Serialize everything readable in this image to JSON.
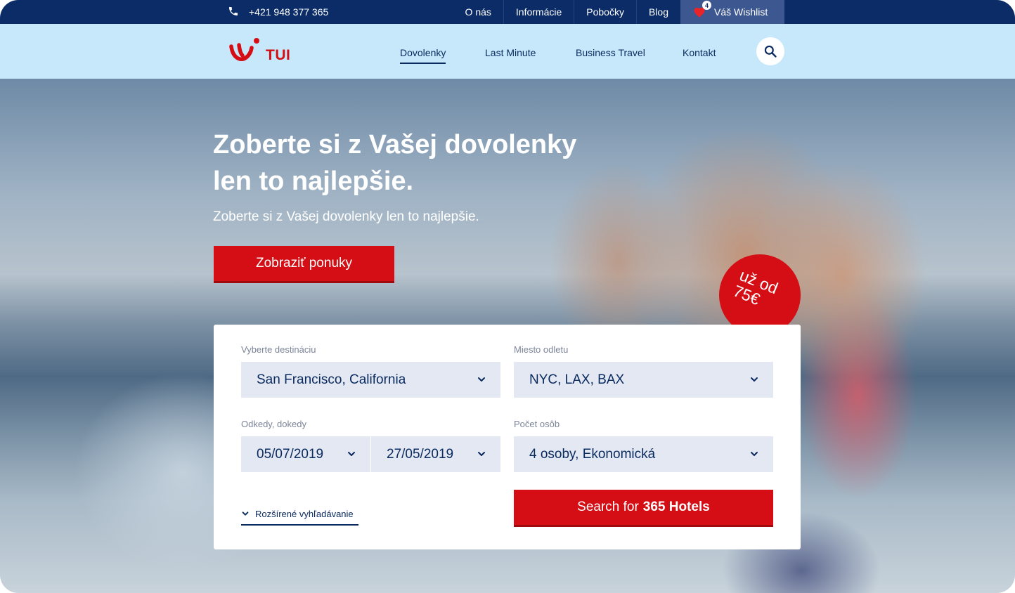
{
  "topbar": {
    "phone": "+421 948 377 365",
    "links": [
      "O nás",
      "Informácie",
      "Pobočky",
      "Blog"
    ],
    "wishlist": {
      "label": "Váš Wishlist",
      "count": "4"
    }
  },
  "nav": {
    "logo_text": "TUI",
    "items": [
      {
        "label": "Dovolenky",
        "active": true
      },
      {
        "label": "Last Minute",
        "active": false
      },
      {
        "label": "Business Travel",
        "active": false
      },
      {
        "label": "Kontakt",
        "active": false
      }
    ]
  },
  "hero": {
    "title": "Zoberte si z Vašej dovolenky len to najlepšie.",
    "subtitle": "Zoberte si z Vašej dovolenky len to najlepšie.",
    "cta_label": "Zobraziť ponuky",
    "badge": {
      "line1": "už od",
      "line2": "75€"
    }
  },
  "search": {
    "destination": {
      "label": "Vyberte destináciu",
      "value": "San Francisco, California"
    },
    "departure": {
      "label": "Miesto odletu",
      "value": "NYC, LAX, BAX"
    },
    "dates": {
      "label": "Odkedy, dokedy",
      "from": "05/07/2019",
      "to": "27/05/2019"
    },
    "people": {
      "label": "Počet osôb",
      "value": "4 osoby, Ekonomická"
    },
    "advanced_label": "Rozšírené vyhľadávanie",
    "button": {
      "prefix": "Search for",
      "bold": "365 Hotels"
    }
  },
  "colors": {
    "brand_red": "#d40e14",
    "navy": "#0b2c66",
    "nav_bg": "#c7e8fb",
    "field_bg": "#e4e8f2"
  },
  "icons": [
    "phone-icon",
    "heart-icon",
    "search-icon",
    "chevron-down-icon"
  ]
}
